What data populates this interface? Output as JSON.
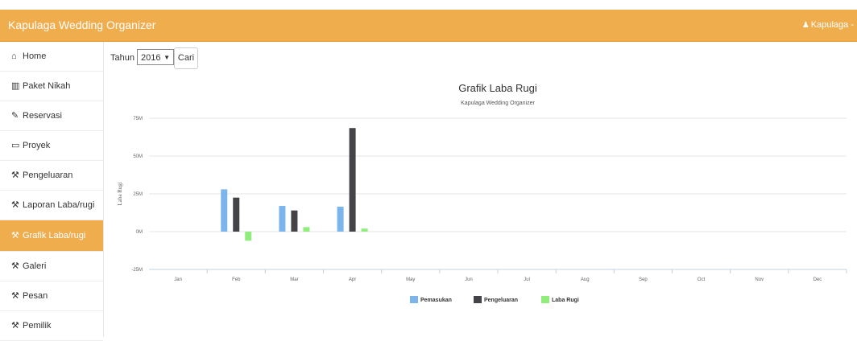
{
  "header": {
    "brand": "Kapulaga Wedding Organizer",
    "user": "Kapulaga -",
    "user_icon": "user-icon",
    "color": "#f0ad4e"
  },
  "sidebar": {
    "items": [
      {
        "label": "Home",
        "icon": "home-icon",
        "glyph": "⌂",
        "active": false
      },
      {
        "label": "Paket Nikah",
        "icon": "bar-chart-icon",
        "glyph": "▥",
        "active": false
      },
      {
        "label": "Reservasi",
        "icon": "edit-icon",
        "glyph": "✎",
        "active": false
      },
      {
        "label": "Proyek",
        "icon": "monitor-icon",
        "glyph": "▭",
        "active": false
      },
      {
        "label": "Pengeluaran",
        "icon": "wrench-icon",
        "glyph": "⚒",
        "active": false
      },
      {
        "label": "Laporan Laba/rugi",
        "icon": "wrench-icon",
        "glyph": "⚒",
        "active": false
      },
      {
        "label": "Grafik Laba/rugi",
        "icon": "wrench-icon",
        "glyph": "⚒",
        "active": true
      },
      {
        "label": "Galeri",
        "icon": "wrench-icon",
        "glyph": "⚒",
        "active": false
      },
      {
        "label": "Pesan",
        "icon": "wrench-icon",
        "glyph": "⚒",
        "active": false
      },
      {
        "label": "Pemilik",
        "icon": "wrench-icon",
        "glyph": "⚒",
        "active": false
      }
    ]
  },
  "filter": {
    "label": "Tahun",
    "year": "2016",
    "search_button": "Cari"
  },
  "chart_data": {
    "type": "bar",
    "title": "Grafik Laba Rugi",
    "subtitle": "Kapulaga Wedding Organizer",
    "ylabel": "Laba Rugi",
    "xlabel": "",
    "categories": [
      "Jan",
      "Feb",
      "Mar",
      "Apr",
      "May",
      "Jun",
      "Jul",
      "Aug",
      "Sep",
      "Oct",
      "Nov",
      "Dec"
    ],
    "ylim": [
      -25,
      75
    ],
    "yticks": [
      -25,
      0,
      25,
      50,
      75
    ],
    "ytick_labels": [
      "-25M",
      "0M",
      "25M",
      "50M",
      "75M"
    ],
    "grid": true,
    "legend_position": "bottom",
    "series": [
      {
        "name": "Pemasukan",
        "color": "#7cb5ec",
        "values": [
          0,
          28,
          17,
          16.5,
          0,
          0,
          0,
          0,
          0,
          0,
          0,
          0
        ]
      },
      {
        "name": "Pengeluaran",
        "color": "#434348",
        "values": [
          0,
          22.5,
          14,
          68.5,
          0,
          0,
          0,
          0,
          0,
          0,
          0,
          0
        ]
      },
      {
        "name": "Laba Rugi",
        "color": "#90ed7d",
        "values": [
          0,
          -6,
          3,
          2,
          0,
          0,
          0,
          0,
          0,
          0,
          0,
          0
        ]
      }
    ]
  }
}
